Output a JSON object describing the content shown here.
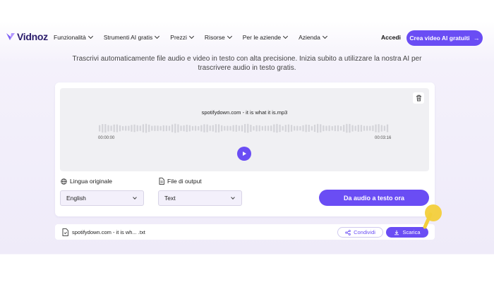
{
  "brand": {
    "name": "Vidnoz"
  },
  "nav": {
    "items": [
      {
        "label": "Funzionalità"
      },
      {
        "label": "Strumenti AI gratis"
      },
      {
        "label": "Prezzi"
      },
      {
        "label": "Risorse"
      },
      {
        "label": "Per le aziende"
      },
      {
        "label": "Azienda"
      }
    ],
    "login_label": "Accedi",
    "cta_label": "Crea video AI gratuiti",
    "cta_arrow": "→"
  },
  "subtitle": "Trascrivi automaticamente file audio e video in testo con alta precisione. Inizia subito a utilizzare la nostra AI per trascrivere audio in testo gratis.",
  "player": {
    "filename": "spotifydown.com - it is what it is.mp3",
    "time_start": "00:00:00",
    "time_end": "00:03:16",
    "icons": [
      "trash-icon",
      "play-icon"
    ]
  },
  "options": {
    "language_label": "Lingua originale",
    "language_value": "English",
    "output_label": "File di output",
    "output_value": "Text",
    "convert_label": "Da audio a testo ora"
  },
  "result": {
    "filename": "spotifydown.com - it is wh... .txt",
    "share_label": "Condividi",
    "download_label": "Scarica"
  },
  "colors": {
    "accent": "#6a4df4",
    "background": "#efebf9",
    "pointer": "#f3cf3b"
  }
}
